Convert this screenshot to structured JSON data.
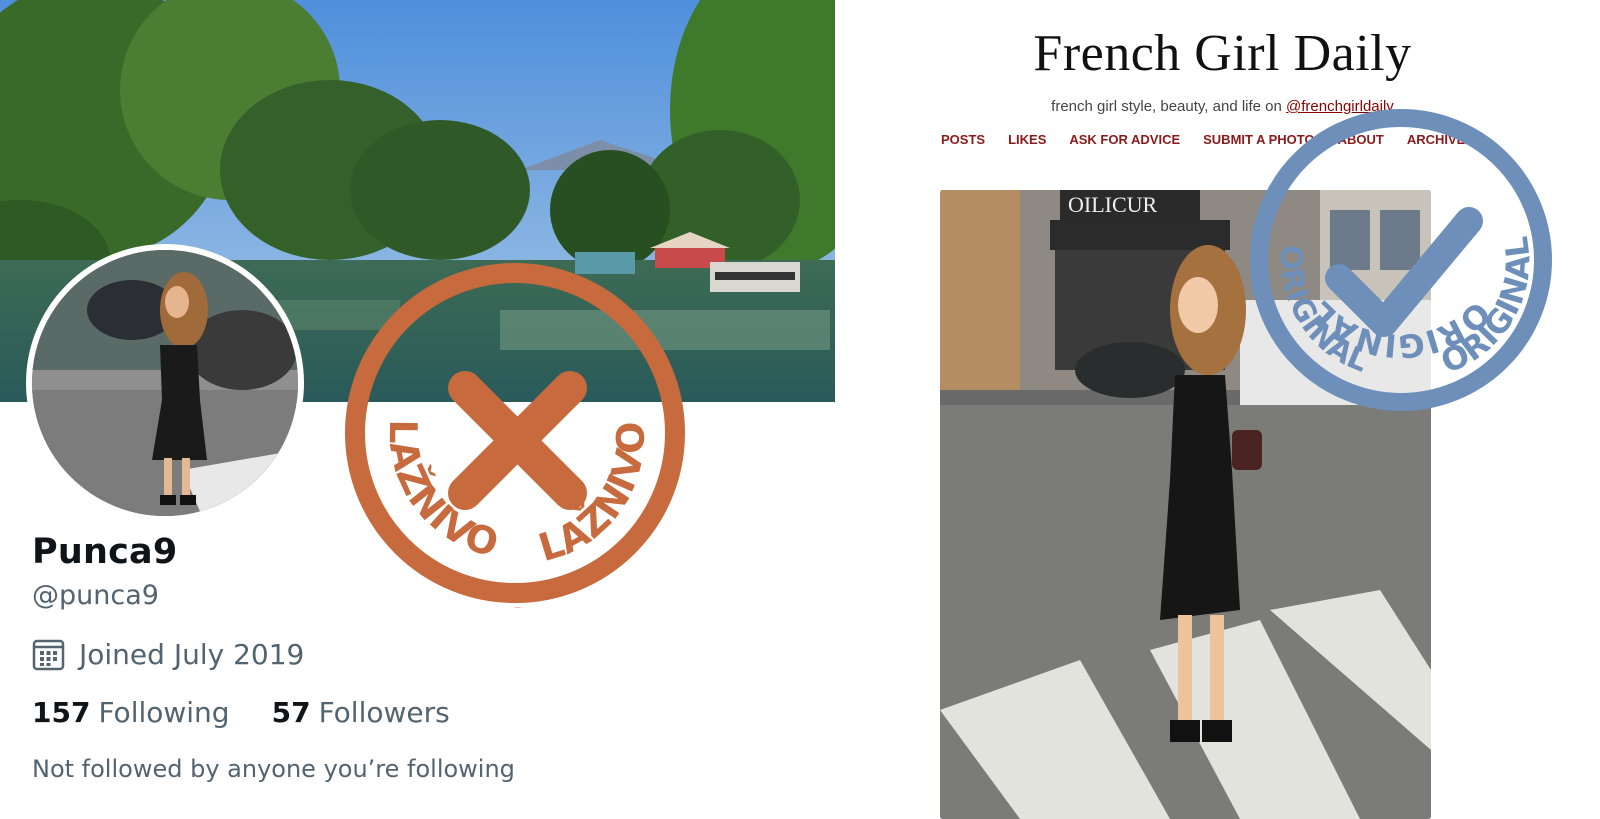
{
  "profile": {
    "display_name": "Punca9",
    "handle": "@punca9",
    "joined": "Joined July 2019",
    "following_count": "157",
    "following_label": "Following",
    "followers_count": "57",
    "followers_label": "Followers",
    "not_followed_text": "Not followed by anyone you’re following",
    "icons": [
      "calendar-icon"
    ]
  },
  "stamps": {
    "fake": {
      "word": "LAŽNIVO",
      "color": "#c76a3d"
    },
    "original": {
      "word": "ORIGINAL",
      "color": "#6d8fba"
    }
  },
  "blog": {
    "title": "French Girl Daily",
    "tagline_prefix": "french girl style, beauty, and life on",
    "tagline_link": "@frenchgirldaily",
    "nav": [
      "POSTS",
      "LIKES",
      "ASK FOR ADVICE",
      "SUBMIT A PHOTO",
      "ABOUT",
      "ARCHIVE"
    ],
    "accent_color": "#8b1a1a",
    "storefront_sign": "OILICUR"
  }
}
